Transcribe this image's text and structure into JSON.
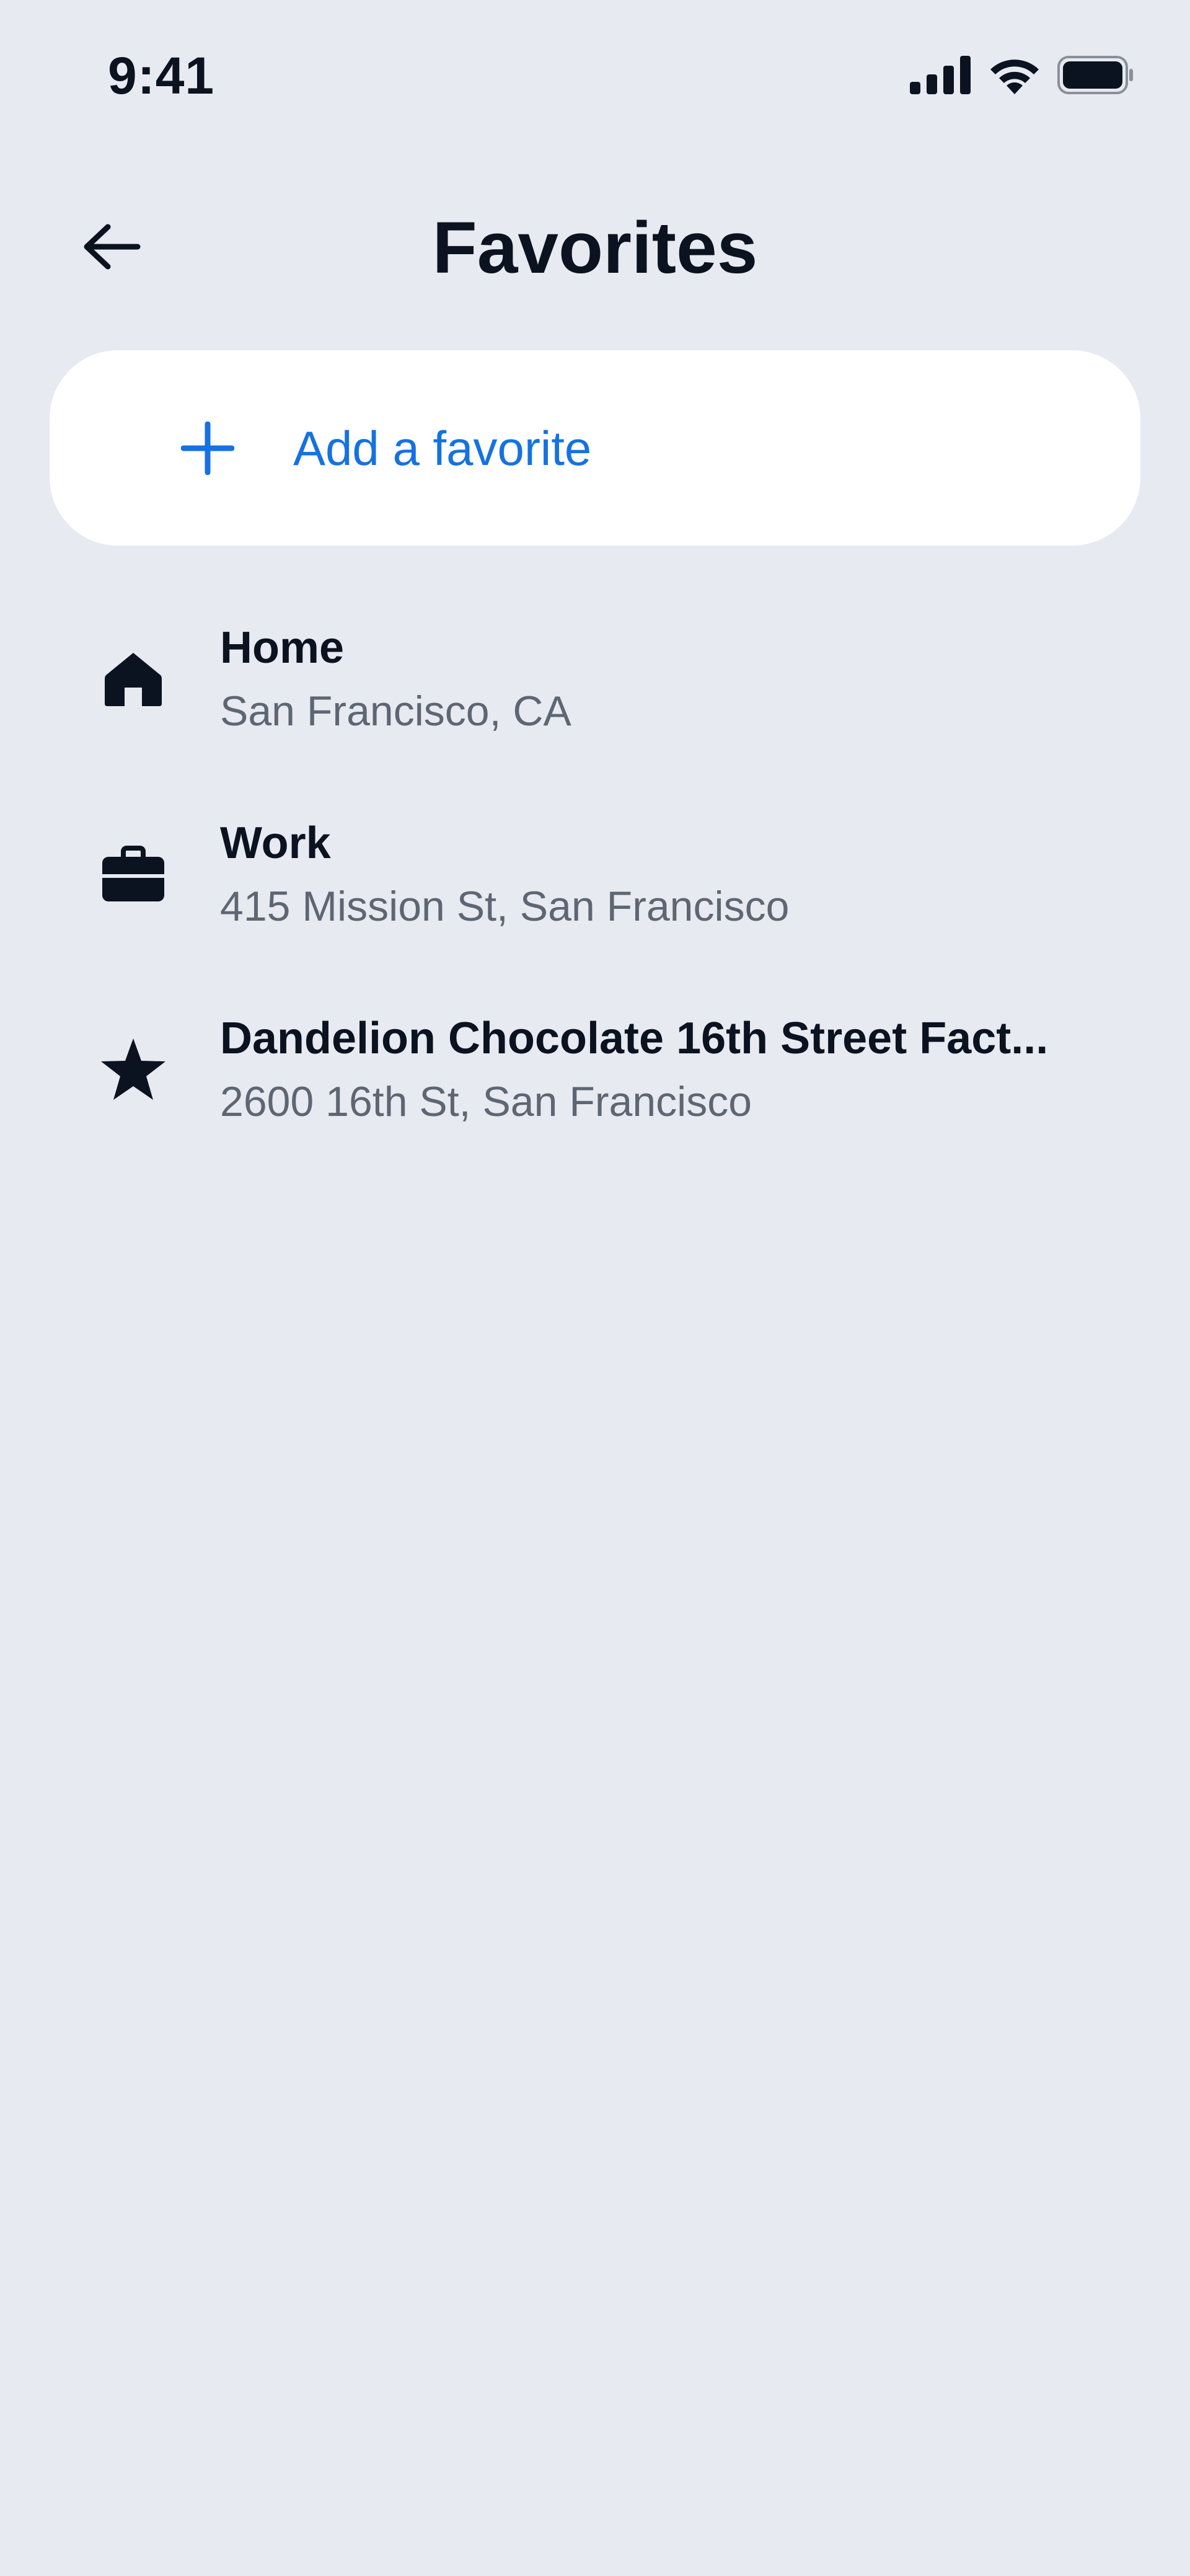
{
  "status_bar": {
    "time": "9:41",
    "icons": [
      "cellular-signal-icon",
      "wifi-icon",
      "battery-icon"
    ]
  },
  "header": {
    "title": "Favorites",
    "back_icon": "arrow-left-icon"
  },
  "add_favorite": {
    "label": "Add a favorite",
    "icon": "plus-icon",
    "color": "#1572E0"
  },
  "favorites": [
    {
      "title": "Home",
      "subtitle": "San Francisco, CA",
      "icon": "home-icon"
    },
    {
      "title": "Work",
      "subtitle": "415 Mission St, San Francisco",
      "icon": "briefcase-icon"
    },
    {
      "title": "Dandelion Chocolate 16th Street Fact...",
      "subtitle": "2600 16th St, San Francisco",
      "icon": "star-icon"
    }
  ],
  "colors": {
    "background": "#E7EAF0",
    "card": "#FFFFFF",
    "text_primary": "#0B1220",
    "text_secondary": "#5E6673",
    "accent": "#1572E0"
  }
}
